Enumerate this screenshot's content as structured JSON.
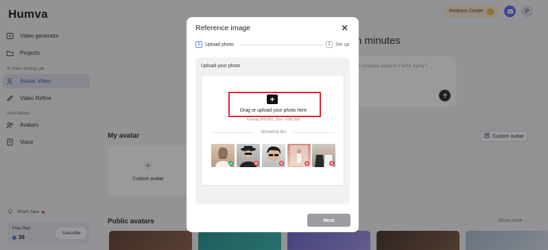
{
  "app": {
    "logo": "Humva"
  },
  "sidebar": {
    "items": [
      {
        "label": "Video generator",
        "icon": "video-generator-icon"
      },
      {
        "label": "Projects",
        "icon": "folder-icon"
      },
      {
        "label": "Avatar Video",
        "icon": "avatar-video-icon",
        "active": true
      },
      {
        "label": "Video Refine",
        "icon": "pen-icon"
      },
      {
        "label": "Avatars",
        "icon": "avatars-icon"
      },
      {
        "label": "Voice",
        "icon": "voice-icon"
      }
    ],
    "sections": [
      "AI Video Editing Lab",
      "Asset library"
    ],
    "whats_new": "What's New",
    "plan": {
      "name": "Free Plan",
      "credits": "36",
      "subscribe": "Subscribe"
    }
  },
  "header": {
    "redeem": "Redeem Center",
    "profile_initial": "P"
  },
  "main": {
    "hero_partial": "n minutes",
    "prompt_placeholder_partial": "r company acquires Factor equity\")",
    "my_avatar_title": "My avatar",
    "custom_avatar_button": "Custom avatar",
    "custom_avatar_card": "Custom avatar",
    "public_avatars_title": "Public avatars",
    "show_more": "Show more →"
  },
  "modal": {
    "title": "Reference image",
    "steps": [
      {
        "number": "1",
        "label": "Upload photo",
        "active": true
      },
      {
        "number": "2",
        "label": "Set up",
        "active": false
      }
    ],
    "panel_title": "Upload your photo",
    "drag_text": "Drag or upload your photo here",
    "format_text": "Format:JPG/PG, Size >256*256",
    "tips_label": "Uploading tips",
    "tips": [
      {
        "ok": true
      },
      {
        "ok": false
      },
      {
        "ok": false
      },
      {
        "ok": false
      },
      {
        "ok": false
      }
    ],
    "next": "Next"
  },
  "colors": {
    "accent": "#6b8fd8",
    "highlight": "#e3222b",
    "ok": "#2fae5a",
    "bad": "#e5383b"
  }
}
